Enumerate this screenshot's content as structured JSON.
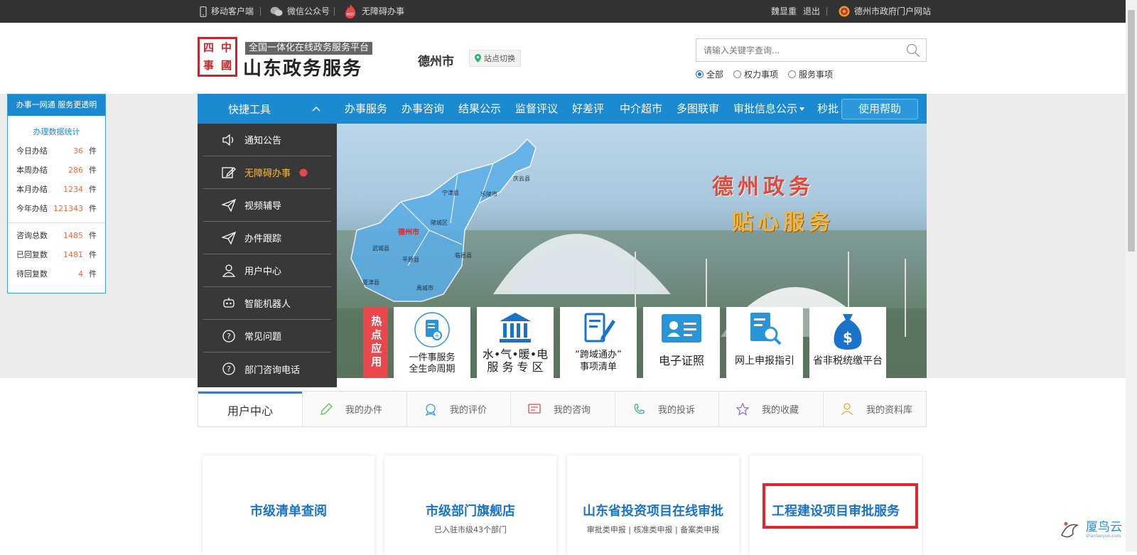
{
  "topbar": {
    "mobile": "移动客户端",
    "wechat": "微信公众号",
    "accessible": "无障碍办事",
    "user": "魏显重",
    "logout": "退出",
    "portal": "德州市政府门户网站"
  },
  "header": {
    "seal_chars": [
      "四",
      "中",
      "事",
      "國"
    ],
    "slogan": "全国一体化在线政务服务平台",
    "brand": "山东政务服务",
    "city": "德州市",
    "switch": "站点切换",
    "search_placeholder": "请输入关键字查询...",
    "radios": [
      "全部",
      "权力事项",
      "服务事项"
    ]
  },
  "stats": {
    "title": "办事一网通  服务更透明",
    "subtitle": "办理数据统计",
    "rows_a": [
      {
        "label": "今日办结",
        "value": "36",
        "unit": "件"
      },
      {
        "label": "本周办结",
        "value": "286",
        "unit": "件"
      },
      {
        "label": "本月办结",
        "value": "1234",
        "unit": "件"
      },
      {
        "label": "今年办结",
        "value": "121343",
        "unit": "件"
      }
    ],
    "rows_b": [
      {
        "label": "咨询总数",
        "value": "1485",
        "unit": "件"
      },
      {
        "label": "已回复数",
        "value": "1481",
        "unit": "件"
      },
      {
        "label": "待回复数",
        "value": "4",
        "unit": "件"
      }
    ]
  },
  "nav": {
    "quick": "快捷工具",
    "items": [
      "办事服务",
      "办事咨询",
      "结果公示",
      "监督评议",
      "好差评",
      "中介超市",
      "多图联审",
      "审批信息公示",
      "秒批"
    ],
    "help": "使用帮助"
  },
  "quickmenu": [
    "通知公告",
    "无障碍办事",
    "视频辅导",
    "办件跟踪",
    "用户中心",
    "智能机器人",
    "常见问题",
    "部门咨询电话"
  ],
  "banner": {
    "line1": "德州政务",
    "line2": "贴心服务",
    "map_city": "德州市",
    "map_labels": [
      "庆云县",
      "宁津县",
      "乐陵市",
      "陵城区",
      "武城县",
      "平原县",
      "临邑县",
      "夏津县",
      "禹城市"
    ]
  },
  "hot": {
    "label": "热点应用",
    "tiles": [
      {
        "line1": "一件事服务",
        "line2": "全生命周期"
      },
      {
        "line1": "水•气•暖•电",
        "line2": "服 务 专 区"
      },
      {
        "line1": "“跨域通办”",
        "line2": "事项清单"
      },
      {
        "line1": "电子证照",
        "line2": ""
      },
      {
        "line1": "网上申报指引",
        "line2": ""
      },
      {
        "line1": "省非税统缴平台",
        "line2": ""
      }
    ]
  },
  "usertabs": [
    "用户中心",
    "我的办件",
    "我的评价",
    "我的咨询",
    "我的投诉",
    "我的收藏",
    "我的资料库"
  ],
  "cards": [
    {
      "title": "市级清单查阅",
      "sub": ""
    },
    {
      "title": "市级部门旗舰店",
      "sub": "已入驻市级43个部门"
    },
    {
      "title": "山东省投资项目在线审批",
      "sub": "审批类申报  |  核准类申报  |  备案类申报"
    },
    {
      "title": "工程建设项目审批服务",
      "sub": ""
    }
  ],
  "watermark": {
    "brand": "厦鸟云",
    "sub": "shanlaoyun.com"
  },
  "colors": {
    "primary": "#1b8ad0",
    "accent_red": "#e3262b",
    "stat_number": "#f06a3c",
    "card_title": "#1a73c9"
  }
}
